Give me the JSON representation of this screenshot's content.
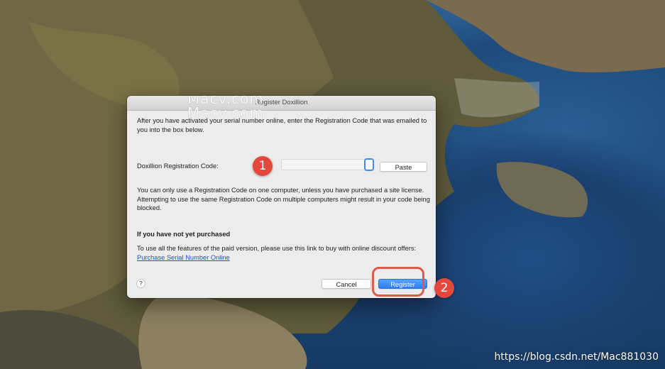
{
  "dialog": {
    "title": "Register Doxillion",
    "watermark": "Macv.com",
    "intro": "After you have activated your serial number online, enter the Registration Code that was emailed to you into the box below.",
    "code_label": "Doxillion Registration Code:",
    "code_value": "",
    "paste_label": "Paste",
    "warning": "You can only use a Registration Code on one computer, unless you have purchased a site license. Attempting to use the same Registration Code on multiple computers might result in your code being blocked.",
    "purchase_heading": "If you have not yet purchased",
    "purchase_text": "To use all the features of the paid version, please use this link to buy with online discount offers:",
    "purchase_link": "Purchase Serial Number Online",
    "help_label": "?",
    "cancel_label": "Cancel",
    "register_label": "Register"
  },
  "annotations": {
    "step1": "1",
    "step2": "2"
  },
  "credit": "https://blog.csdn.net/Mac881030",
  "colors": {
    "accent": "#2f7df3",
    "annotation_red": "#e4473b",
    "link": "#1f4fd8"
  }
}
